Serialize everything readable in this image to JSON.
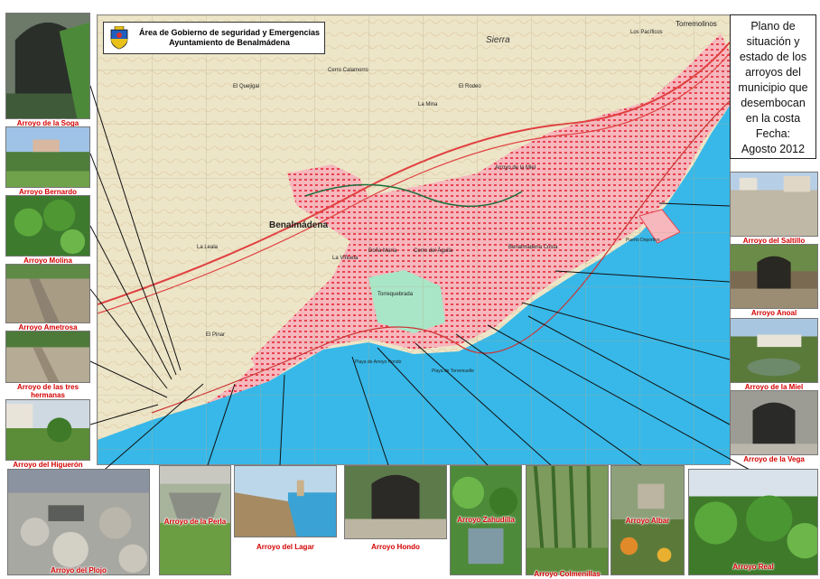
{
  "header": {
    "line1": "Área de Gobierno de seguridad y Emergencias",
    "line2": "Ayuntamiento de Benalmádena"
  },
  "legend": {
    "lines": [
      "Plano de",
      "situación y",
      "estado de los",
      "arroyos del",
      "municipio que",
      "desembocan",
      "en la costa",
      "Fecha:",
      "Agosto 2012"
    ]
  },
  "map_labels": {
    "town": "Benalmádena",
    "sierra": "Sierra",
    "torremolinos": "Torremolinos",
    "costa": "Benalmádena Costa",
    "puerto": "Puerto Deportivo",
    "arroyo_hondo": "Arroyo Hondo",
    "tomaquilla": "Torrequebrada",
    "cerro_calamorro": "Cerro Calamorro",
    "la_mina": "La Mina",
    "el_quejigal": "El Quejigal",
    "arroyo_de_la_miel": "Arroyo de la Miel",
    "el_pinar": "El Pinar",
    "la_viñuela": "La Viñuela",
    "la_leala": "La Leala",
    "el_rodeo": "El Rodeo",
    "playa_arroyo_hondo": "Playa de Arroyo Hondo",
    "colomares": "Torremuelle",
    "doña_maria": "Doña María",
    "cerro_aguila": "Cerro del Águila",
    "la_habana": "Los Pacíficos",
    "jardin_botanico": "Playa de Torremuelle"
  },
  "colors": {
    "sea": "#37b8e8",
    "urban": "#f3a9b0",
    "urban_dark": "#e8434f",
    "terrain": "#ede5c8",
    "green": "#a9e6c7",
    "caption": "#d40000"
  },
  "arroyos": [
    {
      "name": "Arroyo de la Soga"
    },
    {
      "name": "Arroyo Bernardo"
    },
    {
      "name": "Arroyo Molina"
    },
    {
      "name": "Arroyo Ametrosa"
    },
    {
      "name": "Arroyo de las tres hermanas"
    },
    {
      "name": "Arroyo del Higuerón"
    },
    {
      "name": "Arroyo del Plojo"
    },
    {
      "name": "Arroyo de la Perla"
    },
    {
      "name": "Arroyo del Lagar"
    },
    {
      "name": "Arroyo Hondo"
    },
    {
      "name": "Arroyo Zahudilla"
    },
    {
      "name": "Arroyo Colmenillas"
    },
    {
      "name": "Arroyo Albar"
    },
    {
      "name": "Arroyo Real"
    },
    {
      "name": "Arroyo del Saltillo"
    },
    {
      "name": "Arroyo Anoal"
    },
    {
      "name": "Arroyo de la Miel"
    },
    {
      "name": "Arroyo de la Vega"
    }
  ]
}
